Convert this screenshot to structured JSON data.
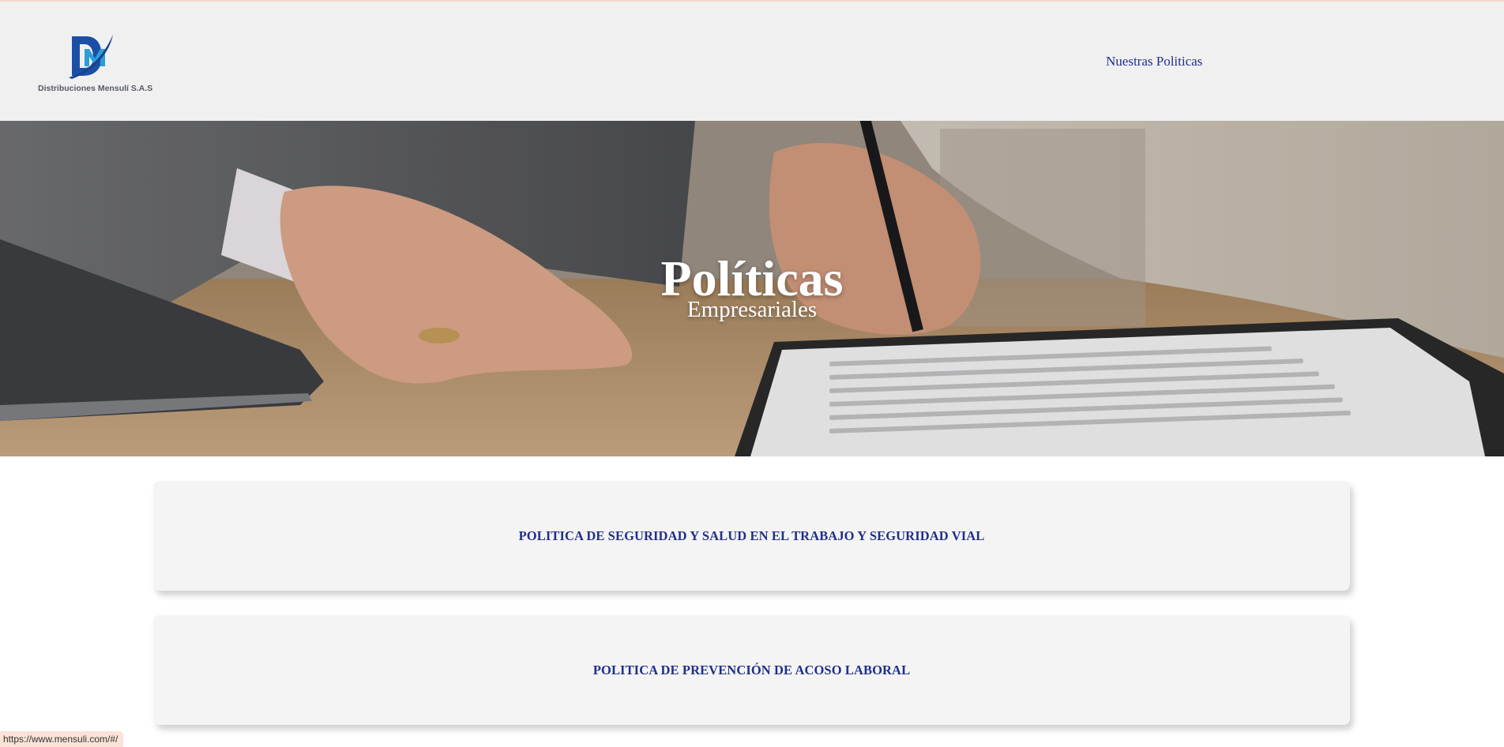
{
  "brand": {
    "company_name": "Distribuciones Mensulí S.A.S",
    "logo_letters": "DM",
    "logo_colors": [
      "#1b4fa6",
      "#2a9fd6"
    ]
  },
  "nav": {
    "link_label": "Nuestras Politicas"
  },
  "hero": {
    "title": "Políticas",
    "subtitle": "Empresariales",
    "image": "business-contract-signing-photo"
  },
  "policies": [
    {
      "label": "POLITICA DE SEGURIDAD Y SALUD EN EL TRABAJO Y SEGURIDAD VIAL"
    },
    {
      "label": "POLITICA DE PREVENCIÓN DE ACOSO LABORAL"
    }
  ],
  "status_bar": {
    "url": "https://www.mensuli.com/#/"
  },
  "colors": {
    "accent": "#1f2f8a",
    "header_bg": "#f0f0f1",
    "card_bg": "#f4f4f5"
  }
}
